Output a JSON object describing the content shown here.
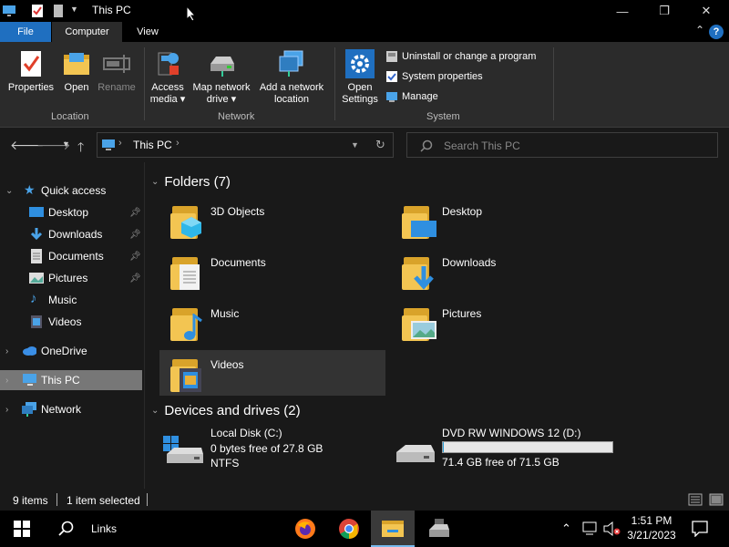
{
  "window": {
    "title": "This PC",
    "minimize_glyph": "—",
    "maximize_glyph": "❐",
    "close_glyph": "✕"
  },
  "ribbon_tabs": {
    "file": "File",
    "computer": "Computer",
    "view": "View",
    "help": "?"
  },
  "ribbon": {
    "location": {
      "label": "Location",
      "properties": "Properties",
      "open": "Open",
      "rename": "Rename"
    },
    "network": {
      "label": "Network",
      "access_media_1": "Access",
      "access_media_2": "media ▾",
      "map_drive_1": "Map network",
      "map_drive_2": "drive ▾",
      "add_location_1": "Add a network",
      "add_location_2": "location"
    },
    "system": {
      "label": "System",
      "open_settings_1": "Open",
      "open_settings_2": "Settings",
      "uninstall": "Uninstall or change a program",
      "system_properties": "System properties",
      "manage": "Manage"
    }
  },
  "address_bar": {
    "path_label": "This PC",
    "search_placeholder": "Search This PC"
  },
  "sidebar": {
    "quick_access": "Quick access",
    "desktop": "Desktop",
    "downloads": "Downloads",
    "documents": "Documents",
    "pictures": "Pictures",
    "music": "Music",
    "videos": "Videos",
    "onedrive": "OneDrive",
    "this_pc": "This PC",
    "network": "Network"
  },
  "content": {
    "folders_header": "Folders (7)",
    "folders": [
      "3D Objects",
      "Desktop",
      "Documents",
      "Downloads",
      "Music",
      "Pictures",
      "Videos"
    ],
    "drives_header": "Devices and drives (2)",
    "drive_c": {
      "name": "Local Disk (C:)",
      "free": "0 bytes free of 27.8 GB",
      "fs": "NTFS"
    },
    "drive_d": {
      "name": "DVD RW WINDOWS 12 (D:)",
      "free": "71.4 GB free of 71.5 GB",
      "used_fraction": 0.0014
    }
  },
  "status": {
    "items": "9 items",
    "selected": "1 item selected"
  },
  "taskbar": {
    "search_label": "Links",
    "time": "1:51 PM",
    "date": "3/21/2023"
  },
  "colors": {
    "accent": "#1f6fc0",
    "folder": "#f3c552",
    "selected_nav": "#777777"
  }
}
